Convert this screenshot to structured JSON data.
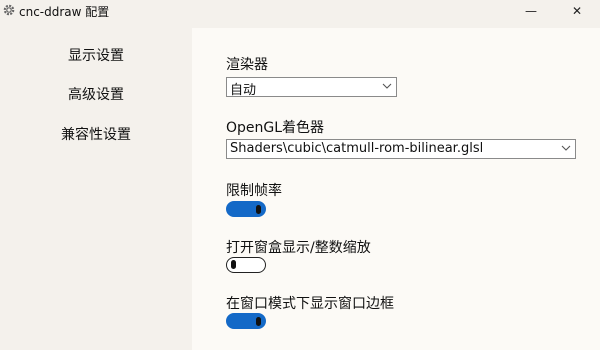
{
  "window": {
    "title": "cnc-ddraw 配置",
    "minimize_glyph": "—",
    "close_glyph": "✕",
    "icon": "gear-icon"
  },
  "sidebar": {
    "items": [
      {
        "label": "显示设置"
      },
      {
        "label": "高级设置"
      },
      {
        "label": "兼容性设置"
      }
    ]
  },
  "settings": {
    "renderer": {
      "label": "渲染器",
      "value": "自动"
    },
    "shader": {
      "label": "OpenGL着色器",
      "value": "Shaders\\cubic\\catmull-rom-bilinear.glsl"
    },
    "limit_fps": {
      "label": "限制帧率",
      "enabled": true
    },
    "boxing": {
      "label": "打开窗盒显示/整数缩放",
      "enabled": false
    },
    "window_border": {
      "label": "在窗口模式下显示窗口边框",
      "enabled": true
    }
  },
  "colors": {
    "accent": "#1469c7",
    "content_bg": "#fcfaf6",
    "sidebar_bg": "#f4f1ec"
  }
}
